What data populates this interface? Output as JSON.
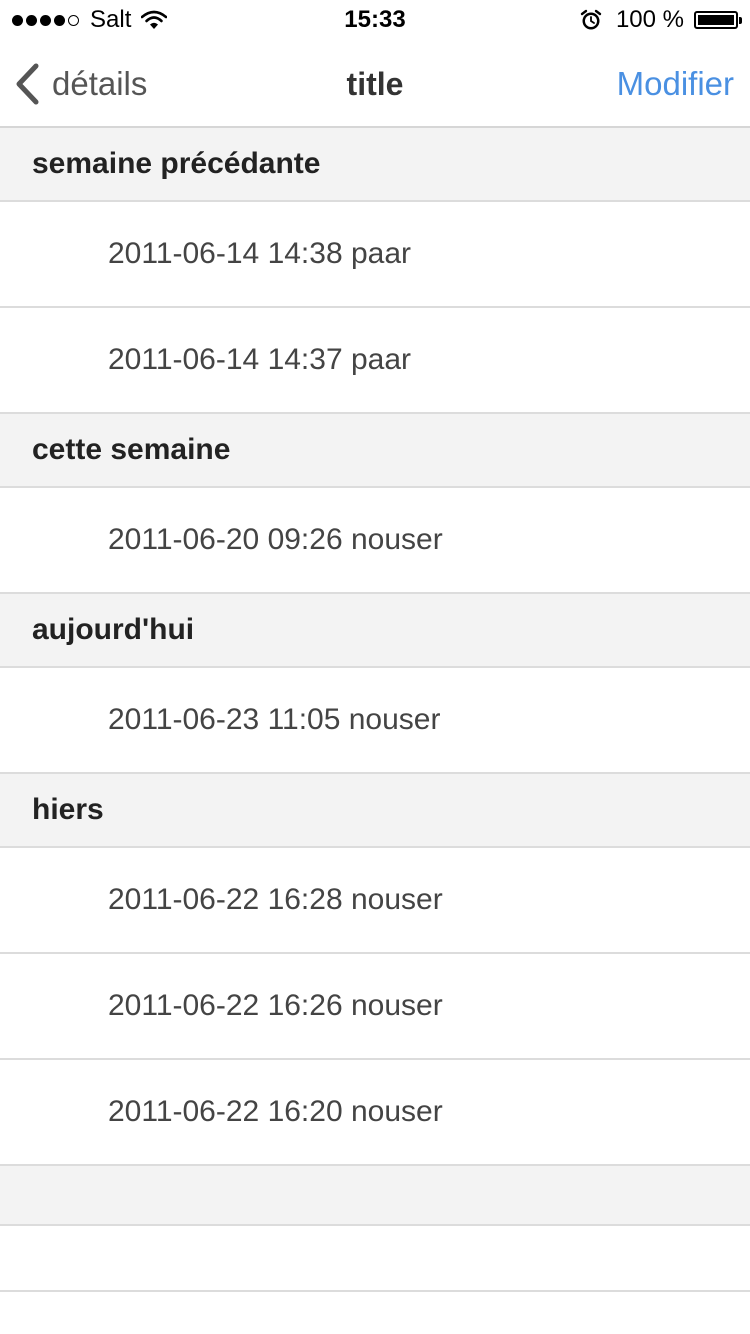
{
  "status_bar": {
    "carrier": "Salt",
    "time": "15:33",
    "battery_percent": "100 %",
    "signal_bars": 4,
    "signal_total": 5,
    "icons": [
      "signal-dots-icon",
      "wifi-icon",
      "alarm-icon",
      "battery-icon"
    ]
  },
  "nav": {
    "back_label": "détails",
    "title": "title",
    "edit_label": "Modifier",
    "accent_color": "#4a90e2"
  },
  "sections": [
    {
      "header": "semaine précédante",
      "rows": [
        "2011-06-14 14:38 paar",
        "2011-06-14 14:37 paar"
      ]
    },
    {
      "header": "cette semaine",
      "rows": [
        "2011-06-20 09:26 nouser"
      ]
    },
    {
      "header": "aujourd'hui",
      "rows": [
        "2011-06-23 11:05 nouser"
      ]
    },
    {
      "header": "hiers",
      "rows": [
        "2011-06-22 16:28 nouser",
        "2011-06-22 16:26 nouser",
        "2011-06-22 16:20 nouser"
      ]
    }
  ]
}
